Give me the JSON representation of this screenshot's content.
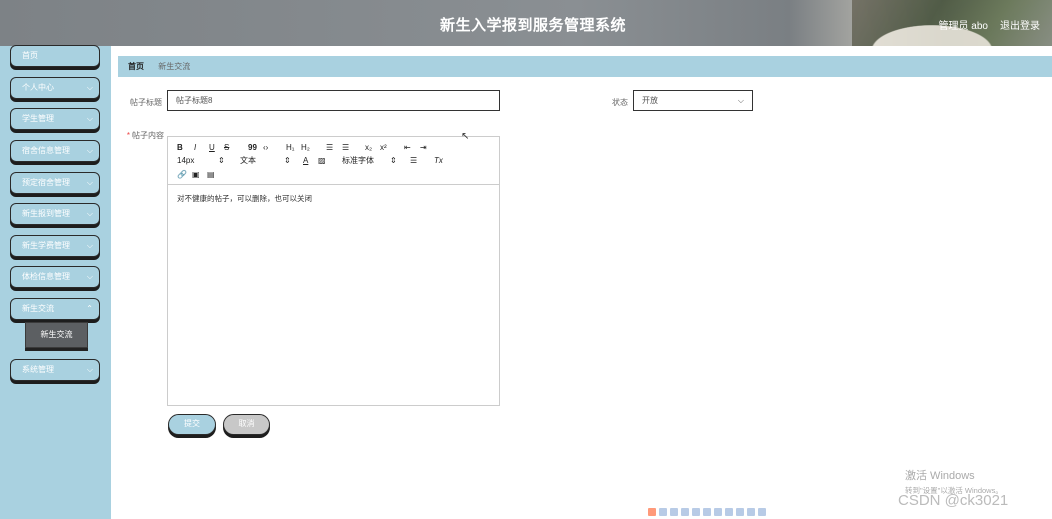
{
  "header": {
    "title": "新生入学报到服务管理系统",
    "user_label": "管理员 abo",
    "logout_label": "退出登录"
  },
  "sidebar": {
    "items": [
      {
        "label": "首页",
        "has_chevron": false
      },
      {
        "label": "个人中心",
        "has_chevron": true
      },
      {
        "label": "学生管理",
        "has_chevron": true
      },
      {
        "label": "宿舍信息管理",
        "has_chevron": true
      },
      {
        "label": "预定宿舍管理",
        "has_chevron": true
      },
      {
        "label": "新生报到管理",
        "has_chevron": true
      },
      {
        "label": "新生学费管理",
        "has_chevron": true
      },
      {
        "label": "体检信息管理",
        "has_chevron": true
      },
      {
        "label": "新生交流",
        "has_chevron": true
      },
      {
        "label": "系统管理",
        "has_chevron": true
      }
    ],
    "sub_item": "新生交流"
  },
  "breadcrumb": {
    "home": "首页",
    "current": "新生交流"
  },
  "form": {
    "title_label": "帖子标题",
    "title_value": "帖子标题8",
    "status_label": "状态",
    "status_value": "开放",
    "content_label": "帖子内容",
    "content_value": "对不健康的帖子，可以删除，也可以关闭",
    "submit_label": "提交",
    "cancel_label": "取消"
  },
  "editor_toolbar": {
    "bold": "B",
    "italic": "I",
    "underline": "U",
    "strike": "S",
    "blockquote": "99",
    "code": "‹›",
    "h1": "H₁",
    "h2": "H₂",
    "ordered_list": "☰",
    "bullet_list": "☰",
    "subscript": "x₂",
    "superscript": "x²",
    "indent_out": "⇤",
    "indent_in": "⇥",
    "font_size": "14px",
    "paragraph": "文本",
    "font_family": "标准字体",
    "font_color": "A",
    "align": "☰",
    "clean": "Tx"
  },
  "watermarks": {
    "windows_line1": "激活 Windows",
    "windows_line2": "转到\"设置\"以激活 Windows。",
    "csdn": "CSDN @ck3021"
  },
  "colors": {
    "accent": "#a9d1e0",
    "submenu": "#5c5f62"
  }
}
